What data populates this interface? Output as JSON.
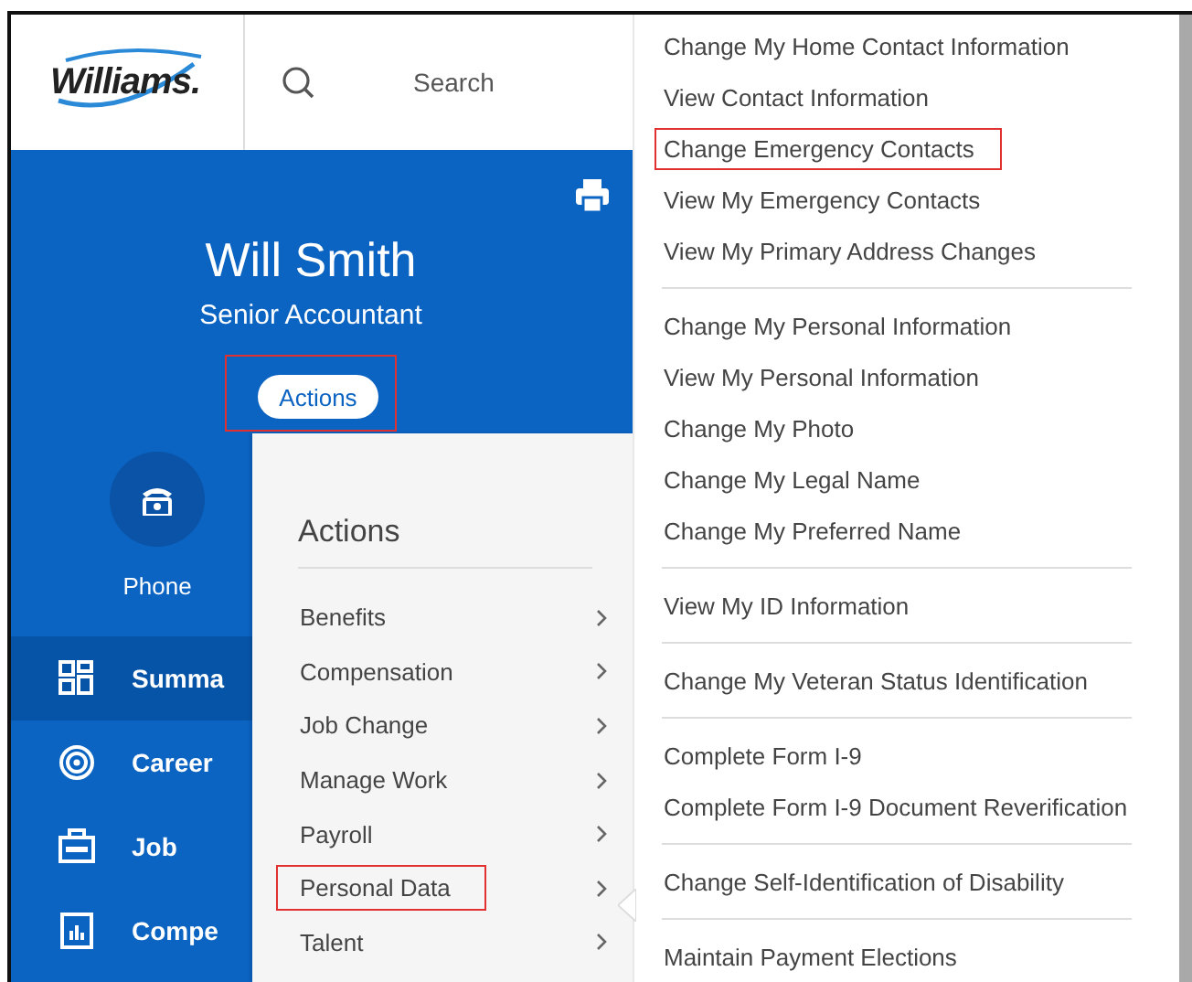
{
  "header": {
    "logo": "Williams.",
    "search": {
      "placeholder": "Search"
    }
  },
  "profile": {
    "name": "Will Smith",
    "title": "Senior Accountant",
    "actions_button": {
      "label": "Actions",
      "highlighted": true
    },
    "contact": {
      "label": "Phone"
    }
  },
  "nav": [
    {
      "label": "Summa",
      "kind": "summary",
      "selected": true
    },
    {
      "label": "Career",
      "kind": "career",
      "selected": false
    },
    {
      "label": "Job",
      "kind": "job",
      "selected": false
    },
    {
      "label": "Compe",
      "kind": "compensation",
      "selected": false
    }
  ],
  "actions_menu": {
    "title": "Actions",
    "items": [
      {
        "label": "Benefits",
        "highlighted": false
      },
      {
        "label": "Compensation",
        "highlighted": false
      },
      {
        "label": "Job Change",
        "highlighted": false
      },
      {
        "label": "Manage Work",
        "highlighted": false
      },
      {
        "label": "Payroll",
        "highlighted": false
      },
      {
        "label": "Personal Data",
        "highlighted": true
      },
      {
        "label": "Talent",
        "highlighted": false
      }
    ]
  },
  "submenu": {
    "groups": [
      [
        {
          "label": "Change My Home Contact Information",
          "highlighted": false
        },
        {
          "label": "View Contact Information",
          "highlighted": false
        },
        {
          "label": "Change Emergency Contacts",
          "highlighted": true
        },
        {
          "label": "View My Emergency Contacts",
          "highlighted": false
        },
        {
          "label": "View My Primary Address Changes",
          "highlighted": false
        }
      ],
      [
        {
          "label": "Change My Personal Information",
          "highlighted": false
        },
        {
          "label": "View My Personal Information",
          "highlighted": false
        },
        {
          "label": "Change My Photo",
          "highlighted": false
        },
        {
          "label": "Change My Legal Name",
          "highlighted": false
        },
        {
          "label": "Change My Preferred Name",
          "highlighted": false
        }
      ],
      [
        {
          "label": "View My ID Information",
          "highlighted": false
        }
      ],
      [
        {
          "label": "Change My Veteran Status Identification",
          "highlighted": false
        }
      ],
      [
        {
          "label": "Complete Form I-9",
          "highlighted": false
        },
        {
          "label": "Complete Form I-9 Document Reverification",
          "highlighted": false
        }
      ],
      [
        {
          "label": "Change Self-Identification of Disability",
          "highlighted": false
        }
      ],
      [
        {
          "label": "Maintain Payment Elections",
          "highlighted": false
        }
      ]
    ]
  }
}
